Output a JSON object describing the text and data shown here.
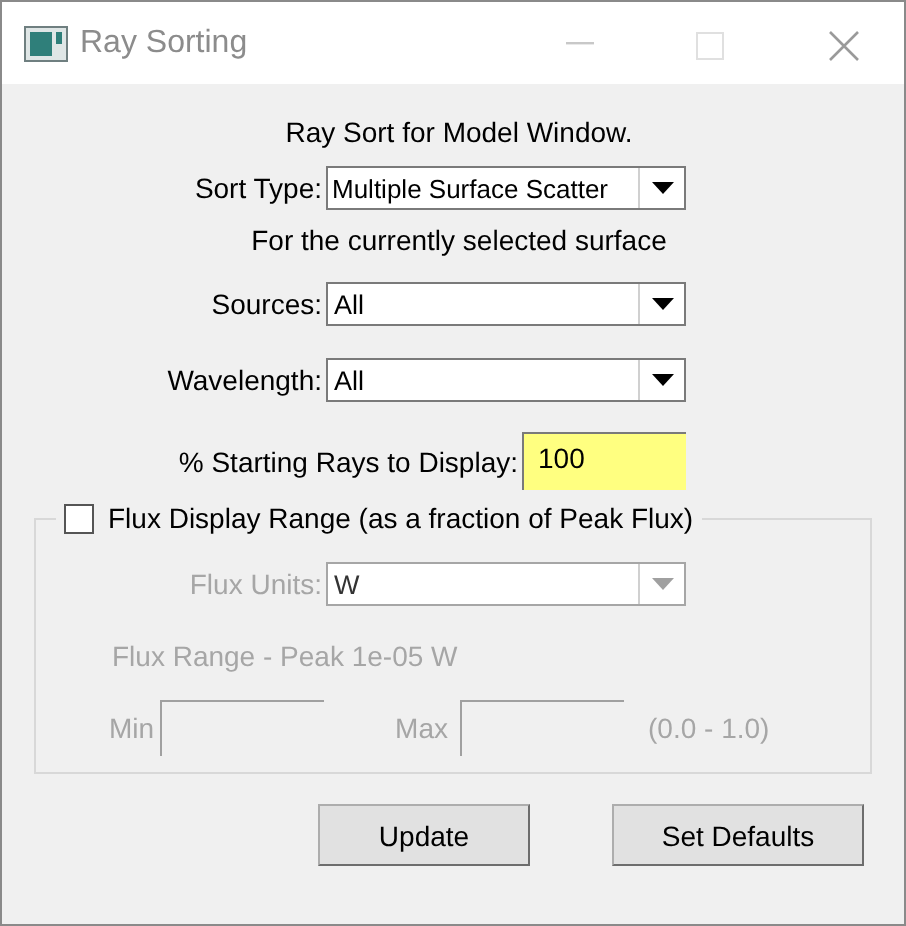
{
  "window": {
    "title": "Ray Sorting"
  },
  "heading": "Ray Sort for Model Window.",
  "sort_type": {
    "label": "Sort Type:",
    "value": "Multiple Surface Scatter"
  },
  "note": "For the currently selected surface",
  "fields": [
    {
      "kind": "dropdown",
      "label": "Sources:",
      "value": "All"
    },
    {
      "kind": "dropdown",
      "label": "Wavelength:",
      "value": "All"
    },
    {
      "kind": "text",
      "label": "% Starting Rays to Display:",
      "value": "100"
    }
  ],
  "flux_group": {
    "label": "Flux Display Range (as a fraction of Peak Flux)",
    "checked": false,
    "units": {
      "label": "Flux Units:",
      "value": "W",
      "disabled": true
    },
    "range_text": "Flux Range - Peak 1e-05 W",
    "min": {
      "label": "Min",
      "disabled": true
    },
    "max": {
      "label": "Max",
      "disabled": true
    },
    "hint": "(0.0 - 1.0)"
  },
  "buttons": [
    "Update",
    "Set Defaults"
  ]
}
